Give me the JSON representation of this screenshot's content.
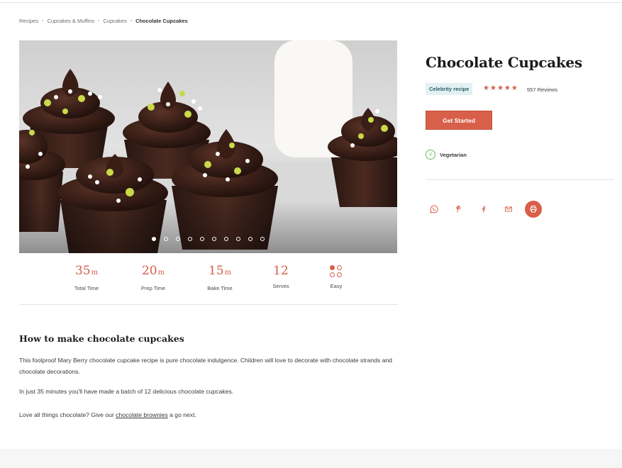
{
  "breadcrumb": [
    {
      "label": "Recipes"
    },
    {
      "label": "Cupcakes & Muffins"
    },
    {
      "label": "Cupcakes"
    },
    {
      "label": "Chocolate Cupcakes"
    }
  ],
  "carousel": {
    "slide_count": 10,
    "active_index": 0
  },
  "stats": [
    {
      "value": "35",
      "unit": "m",
      "label": "Total Time"
    },
    {
      "value": "20",
      "unit": "m",
      "label": "Prep Time"
    },
    {
      "value": "15",
      "unit": "m",
      "label": "Bake Time"
    },
    {
      "value": "12",
      "unit": "",
      "label": "Serves"
    },
    {
      "value": "",
      "unit": "",
      "label": "Easy"
    }
  ],
  "difficulty": {
    "level": "Easy",
    "filled": 1,
    "total": 4
  },
  "content": {
    "title": "How to make chocolate cupcakes",
    "para1": "This foolproof Mary Berry chocolate cupcake recipe is pure chocolate indulgence. Children will love to decorate with chocolate strands and chocolate decorations.",
    "para2": "In just 35 minutes you'll have made a batch of 12 delicious chocolate cupcakes.",
    "para3_prefix": "Love all things chocolate? Give our ",
    "para3_link": "chocolate brownies",
    "para3_suffix": " a go next."
  },
  "recipe": {
    "title": "Chocolate Cupcakes",
    "badge": "Celebrity recipe",
    "rating": 5,
    "reviews": "557 Reviews",
    "cta": "Get Started",
    "diet_icon_letter": "V",
    "diet": "Vegetarian"
  },
  "share": [
    {
      "icon": "whatsapp-icon"
    },
    {
      "icon": "pinterest-icon"
    },
    {
      "icon": "facebook-icon"
    },
    {
      "icon": "email-icon"
    },
    {
      "icon": "print-icon"
    }
  ],
  "colors": {
    "accent": "#d85f49",
    "badge_bg": "#e2f1f3",
    "veg": "#6abd5a"
  }
}
